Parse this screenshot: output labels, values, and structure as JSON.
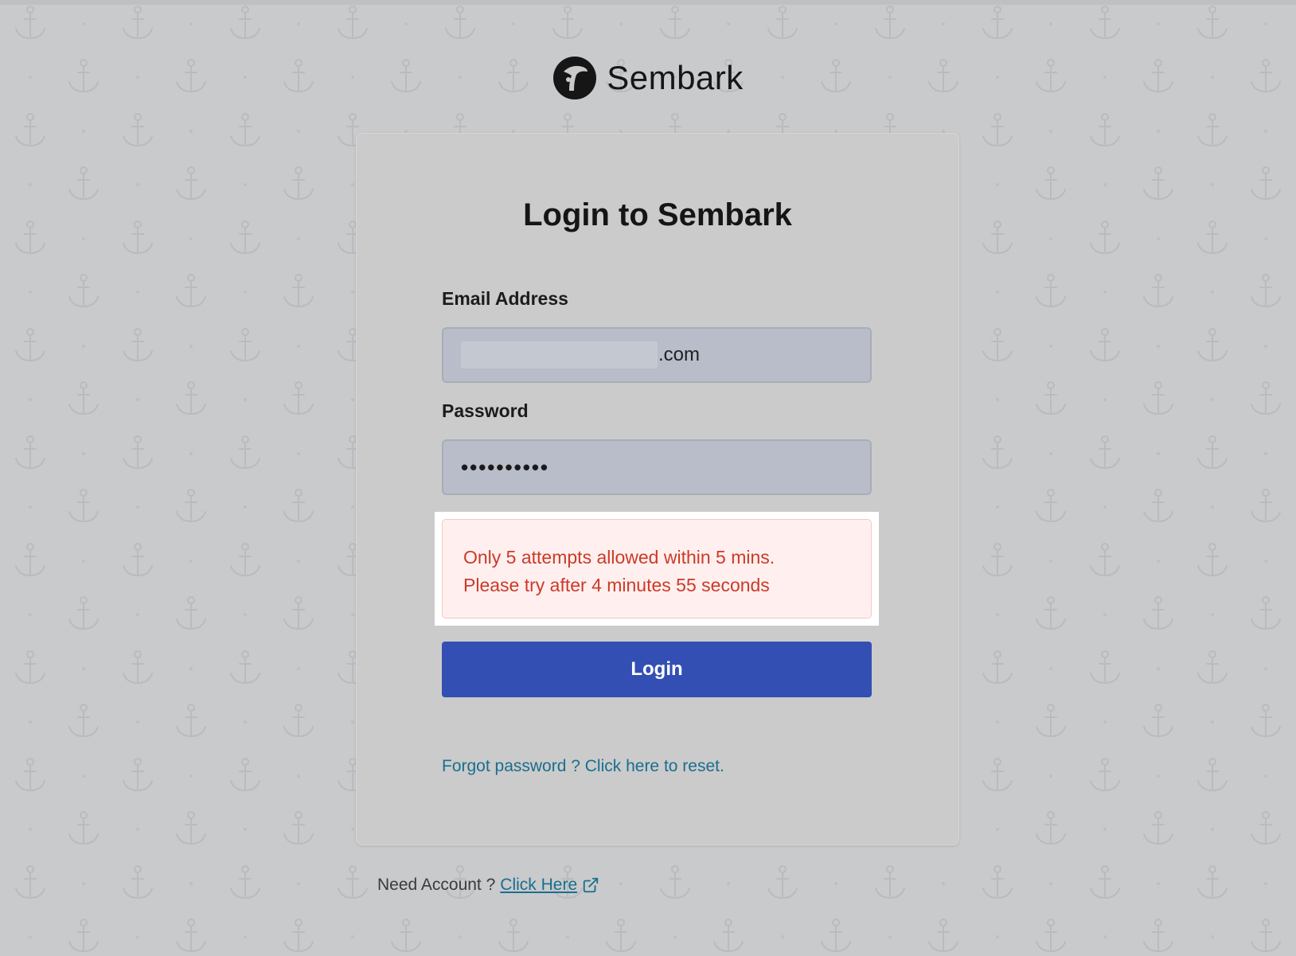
{
  "brand": {
    "name": "Sembark",
    "logo_icon": "sembark-logo-icon"
  },
  "login_card": {
    "title": "Login to Sembark",
    "email": {
      "label": "Email Address",
      "value_visible_suffix": ".com"
    },
    "password": {
      "label": "Password",
      "masked_value": "••••••••••"
    },
    "error": {
      "line1": "Only 5 attempts allowed within 5 mins.",
      "line2": "Please try after 4 minutes 55 seconds"
    },
    "login_button": "Login",
    "forgot_link": "Forgot password ? Click here to reset."
  },
  "footer": {
    "prompt": "Need Account ?",
    "link_label": "Click Here",
    "link_icon": "external-link-icon"
  },
  "colors": {
    "background": "#c9cacc",
    "card": "#cbcbcb",
    "input_bg": "#b8bdc9",
    "error_text": "#cc3a28",
    "error_bg": "#fff0ef",
    "primary_button": "#334fb3",
    "link": "#1a6e8e"
  }
}
